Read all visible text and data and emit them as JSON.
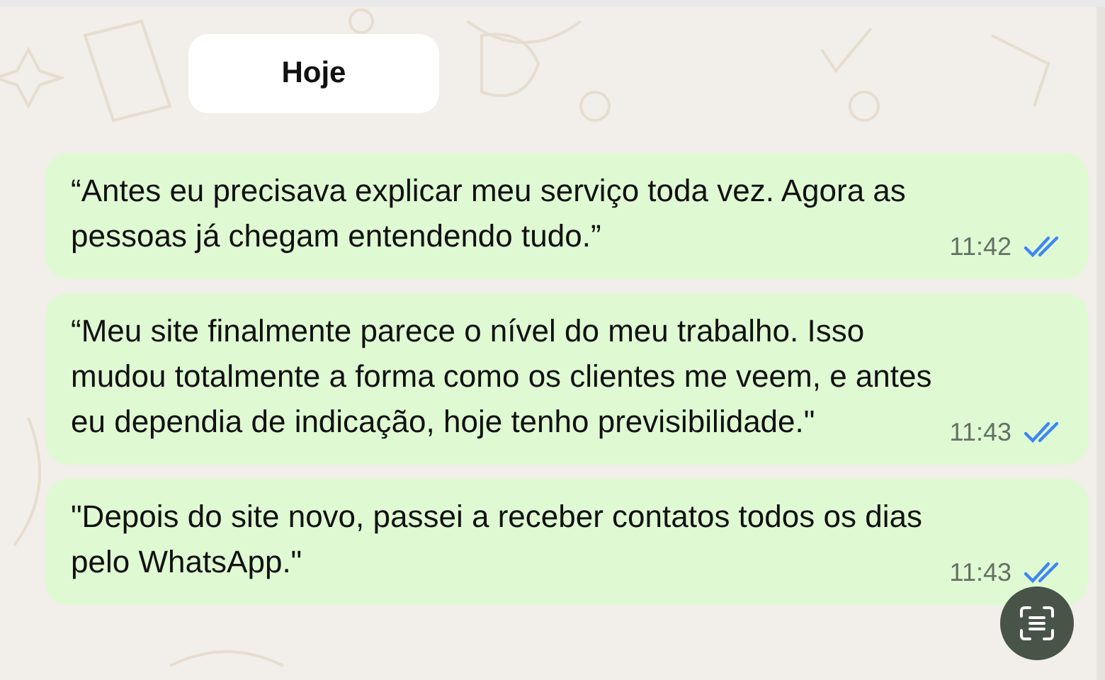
{
  "date_chip": "Hoje",
  "messages": [
    {
      "text": "“Antes eu precisava explicar meu serviço toda vez. Agora as pessoas já chegam entendendo tudo.”",
      "time": "11:42",
      "read": true
    },
    {
      "text": "“Meu site finalmente parece o nível do meu trabalho. Isso mudou totalmente a forma como os clientes me veem, e antes eu dependia de indicação, hoje tenho previsibilidade.\"",
      "time": "11:43",
      "read": true
    },
    {
      "text": "\"Depois do site novo, passei a receber contatos todos os dias pelo WhatsApp.\"",
      "time": "11:43",
      "read": true
    }
  ]
}
